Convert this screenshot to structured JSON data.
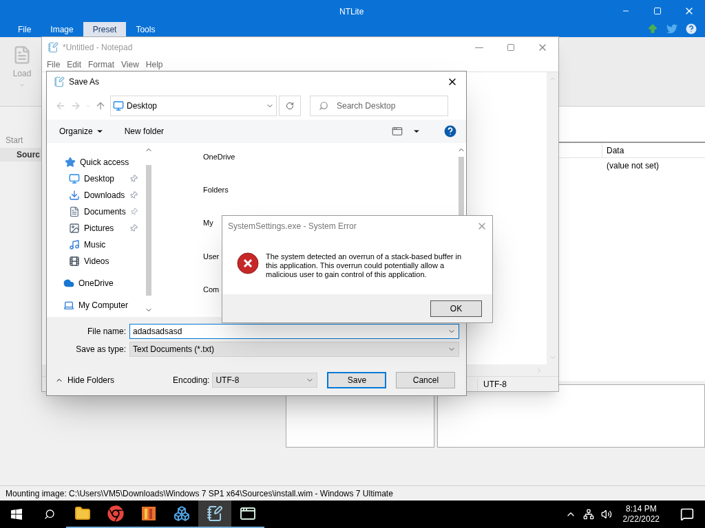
{
  "ntlite": {
    "title": "NTLite",
    "menu": [
      {
        "label": "File",
        "selected": false
      },
      {
        "label": "Image",
        "selected": false
      },
      {
        "label": "Preset",
        "selected": true
      },
      {
        "label": "Tools",
        "selected": false
      }
    ],
    "ribbon": {
      "load": "Load"
    },
    "nav": {
      "section": "Start",
      "tab": "Sourc"
    },
    "table": {
      "columns": [
        "Data"
      ],
      "rows": [
        [
          "(value not set)"
        ]
      ]
    },
    "status_bar": "Mounting image: C:\\Users\\VM5\\Downloads\\Windows 7 SP1 x64\\Sources\\install.wim - Windows 7 Ultimate"
  },
  "notepad": {
    "title": "*Untitled - Notepad",
    "menu": [
      "File",
      "Edit",
      "Format",
      "View",
      "Help"
    ],
    "encoding": "UTF-8"
  },
  "save_as": {
    "title": "Save As",
    "location": "Desktop",
    "search": {
      "placeholder": "Search Desktop"
    },
    "toolbar": [
      "Organize",
      "New folder"
    ],
    "nav": [
      {
        "label": "Quick access",
        "kind": "star",
        "pinned": false,
        "children": [
          {
            "label": "Desktop",
            "kind": "desktop",
            "pinned": true
          },
          {
            "label": "Downloads",
            "kind": "download",
            "pinned": true
          },
          {
            "label": "Documents",
            "kind": "document",
            "pinned": true
          },
          {
            "label": "Pictures",
            "kind": "pictures",
            "pinned": true
          },
          {
            "label": "Music",
            "kind": "music",
            "pinned": false
          },
          {
            "label": "Videos",
            "kind": "videos",
            "pinned": false
          }
        ]
      },
      {
        "label": "OneDrive",
        "kind": "cloud",
        "pinned": false
      },
      {
        "label": "My Computer",
        "kind": "computer",
        "pinned": false
      }
    ],
    "items": [
      "OneDrive",
      "Folders",
      "My",
      "User",
      "Com"
    ],
    "file_name_label": "File name:",
    "file_name": "adadsadsasd",
    "type_label": "Save as type:",
    "save_as_type": "Text Documents (*.txt)",
    "hide_folders": "Hide Folders",
    "encoding_label": "Encoding:",
    "encoding": "UTF-8",
    "buttons": [
      {
        "label": "Save",
        "default": true
      },
      {
        "label": "Cancel",
        "default": false
      }
    ]
  },
  "error": {
    "title": "SystemSettings.exe - System Error",
    "message": "The system detected an overrun of a stack-based buffer in this application. This overrun could potentially allow a malicious user to gain control of this application.",
    "button": "OK"
  },
  "taskbar": {
    "apps": [
      {
        "kind": "folder",
        "active": false
      },
      {
        "kind": "chrome",
        "active": false
      },
      {
        "kind": "ntlite",
        "active": false
      },
      {
        "kind": "cubes",
        "active": false
      },
      {
        "kind": "notepad",
        "active": true
      },
      {
        "kind": "window",
        "active": false
      }
    ],
    "time": "8:14 PM",
    "date": "2/22/2022"
  }
}
